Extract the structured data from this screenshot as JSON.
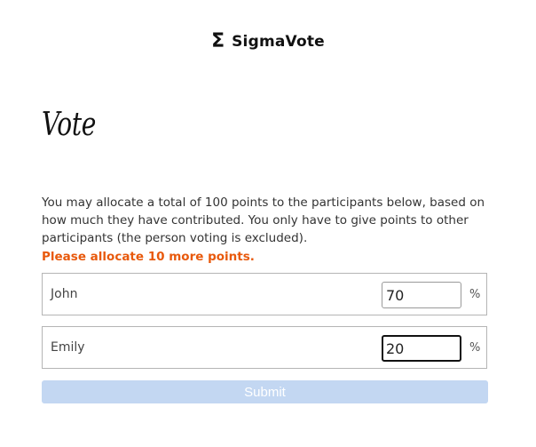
{
  "brand": {
    "icon_glyph": "Σ",
    "icon_name": "sigma-logo-icon",
    "name": "SigmaVote"
  },
  "page": {
    "title": "Vote",
    "description": "You may allocate a total of 100 points to the participants below, based on how much they have contributed. You only have to give points to other participants (the person voting is excluded).",
    "warning": "Please allocate 10 more points.",
    "warning_color": "#e8590c"
  },
  "participants": [
    {
      "name": "John",
      "points": "70",
      "unit": "%",
      "focused": false
    },
    {
      "name": "Emily",
      "points": "20",
      "unit": "%",
      "focused": true
    }
  ],
  "submit": {
    "label": "Submit",
    "disabled": true,
    "color": "#c3d7f2"
  }
}
